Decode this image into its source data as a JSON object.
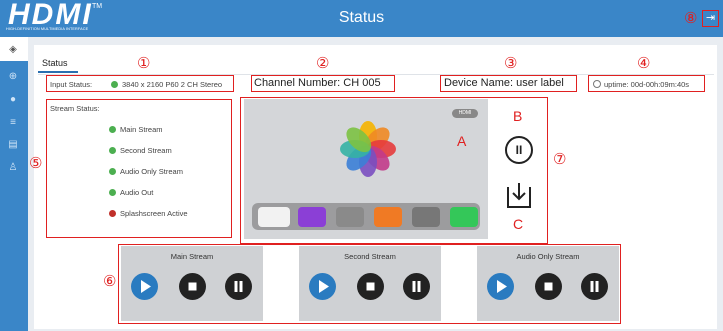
{
  "header": {
    "logo_text": "HDMI",
    "logo_tm": "TM",
    "logo_sub": "HIGH-DEFINITION MULTIMEDIA INTERFACE",
    "title": "Status"
  },
  "tab": {
    "label": "Status"
  },
  "input_status": {
    "label": "Input Status:",
    "value": "3840 x 2160 P60 2 CH Stereo"
  },
  "channel_number": "Channel Number: CH 005",
  "device_name": "Device Name: user label",
  "uptime": "uptime: 00d-00h:09m:40s",
  "stream_status": {
    "label": "Stream Status:",
    "items": [
      {
        "label": "Main Stream",
        "status_color": "#4caf50"
      },
      {
        "label": "Second Stream",
        "status_color": "#4caf50"
      },
      {
        "label": "Audio Only Stream",
        "status_color": "#4caf50"
      },
      {
        "label": "Audio Out",
        "status_color": "#4caf50"
      },
      {
        "label": "Splashscreen Active",
        "status_color": "#c0302a"
      }
    ]
  },
  "preview_badge": "HDMI",
  "markers": {
    "m1": "①",
    "m2": "②",
    "m3": "③",
    "m4": "④",
    "m5": "⑤",
    "m6": "⑥",
    "m7": "⑦",
    "m8": "⑧"
  },
  "letters": {
    "a": "A",
    "b": "B",
    "c": "C"
  },
  "panels": [
    {
      "title": "Main Stream"
    },
    {
      "title": "Second Stream"
    },
    {
      "title": "Audio Only Stream"
    }
  ],
  "colors": {
    "header": "#3a86c8",
    "annotation": "#e02020",
    "play": "#2a7bc0"
  }
}
